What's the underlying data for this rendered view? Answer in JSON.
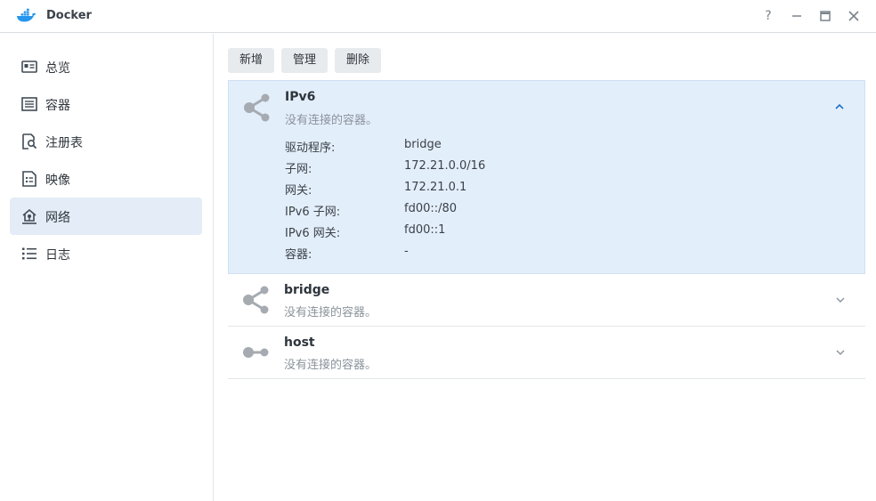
{
  "window": {
    "title": "Docker",
    "help_label": "?",
    "brand_color": "#2496ed"
  },
  "sidebar": {
    "items": [
      {
        "label": "总览",
        "icon": "overview-card-icon"
      },
      {
        "label": "容器",
        "icon": "container-list-icon"
      },
      {
        "label": "注册表",
        "icon": "registry-search-icon"
      },
      {
        "label": "映像",
        "icon": "image-document-icon"
      },
      {
        "label": "网络",
        "icon": "network-house-icon",
        "active": true
      },
      {
        "label": "日志",
        "icon": "log-list-icon"
      }
    ]
  },
  "toolbar": {
    "add_label": "新增",
    "manage_label": "管理",
    "delete_label": "删除"
  },
  "networks": [
    {
      "name": "IPv6",
      "status": "没有连接的容器。",
      "expanded": true,
      "details": [
        {
          "key": "驱动程序:",
          "value": "bridge"
        },
        {
          "key": "子网:",
          "value": "172.21.0.0/16"
        },
        {
          "key": "网关:",
          "value": "172.21.0.1"
        },
        {
          "key": "IPv6 子网:",
          "value": "fd00::/80"
        },
        {
          "key": "IPv6 网关:",
          "value": "fd00::1"
        },
        {
          "key": "容器:",
          "value": "-"
        }
      ]
    },
    {
      "name": "bridge",
      "status": "没有连接的容器。",
      "expanded": false
    },
    {
      "name": "host",
      "status": "没有连接的容器。",
      "expanded": false
    }
  ]
}
